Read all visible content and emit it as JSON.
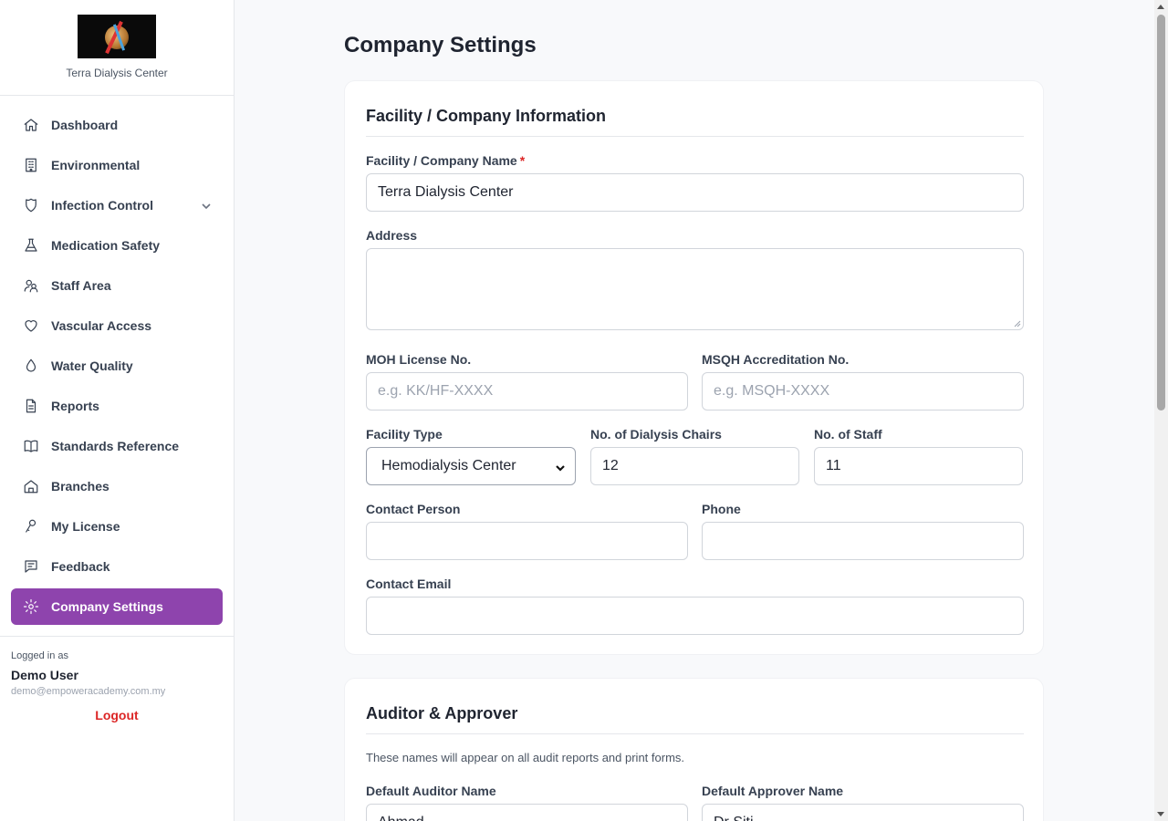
{
  "brand": {
    "name": "Terra Dialysis Center"
  },
  "nav": [
    {
      "label": "Dashboard",
      "icon": "home-icon"
    },
    {
      "label": "Environmental",
      "icon": "building-icon"
    },
    {
      "label": "Infection Control",
      "icon": "shield-icon",
      "expandable": true
    },
    {
      "label": "Medication Safety",
      "icon": "flask-icon"
    },
    {
      "label": "Staff Area",
      "icon": "users-icon"
    },
    {
      "label": "Vascular Access",
      "icon": "heart-icon"
    },
    {
      "label": "Water Quality",
      "icon": "droplet-icon"
    },
    {
      "label": "Reports",
      "icon": "document-icon"
    },
    {
      "label": "Standards Reference",
      "icon": "book-icon"
    },
    {
      "label": "Branches",
      "icon": "branch-home-icon"
    },
    {
      "label": "My License",
      "icon": "key-icon"
    },
    {
      "label": "Feedback",
      "icon": "message-icon"
    },
    {
      "label": "Company Settings",
      "icon": "gear-icon",
      "active": true
    }
  ],
  "user": {
    "logged_label": "Logged in as",
    "name": "Demo User",
    "email": "demo@empoweracademy.com.my",
    "logout": "Logout"
  },
  "page": {
    "title": "Company Settings"
  },
  "facility": {
    "title": "Facility / Company Information",
    "name_label": "Facility / Company Name",
    "required_mark": "*",
    "name_value": "Terra Dialysis Center",
    "address_label": "Address",
    "address_value": "",
    "moh_label": "MOH License No.",
    "moh_placeholder": "e.g. KK/HF-XXXX",
    "msqh_label": "MSQH Accreditation No.",
    "msqh_placeholder": "e.g. MSQH-XXXX",
    "type_label": "Facility Type",
    "type_value": "Hemodialysis Center",
    "chairs_label": "No. of Dialysis Chairs",
    "chairs_value": "12",
    "staff_label": "No. of Staff",
    "staff_value": "11",
    "contact_label": "Contact Person",
    "contact_value": "",
    "phone_label": "Phone",
    "phone_value": "",
    "email_label": "Contact Email",
    "email_value": ""
  },
  "auditor": {
    "title": "Auditor & Approver",
    "description": "These names will appear on all audit reports and print forms.",
    "auditor_label": "Default Auditor Name",
    "auditor_value": "Ahmad",
    "approver_label": "Default Approver Name",
    "approver_value": "Dr Siti"
  },
  "colors": {
    "accent": "#8e44ad",
    "required": "#dc2626",
    "logout": "#dc2626"
  }
}
